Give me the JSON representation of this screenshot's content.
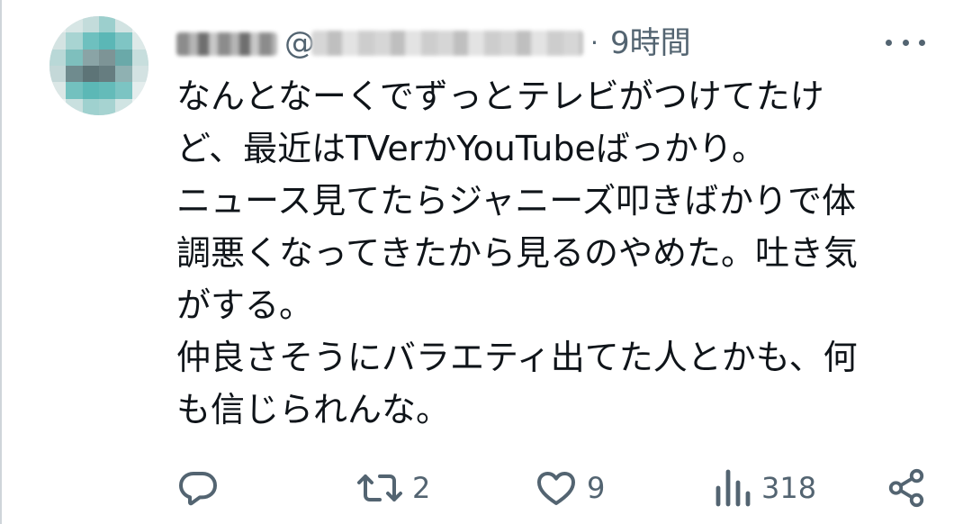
{
  "tweet": {
    "author_name_blurred": "",
    "handle_prefix": "@",
    "separator": "·",
    "timestamp": "9時間",
    "text_lines": [
      "なんとなーくでずっとテレビがつけてたけ",
      "ど、最近はTVerかYouTubeばっかり。",
      "ニュース見てたらジャニーズ叩きばかりで体",
      "調悪くなってきたから見るのやめた。吐き気",
      "がする。",
      "仲良さそうにバラエティ出てた人とかも、何",
      "も信じられんな。"
    ]
  },
  "actions": {
    "reply_icon": "reply-icon",
    "retweet_icon": "retweet-icon",
    "retweet_count": "2",
    "like_icon": "heart-icon",
    "like_count": "9",
    "views_icon": "views-icon",
    "views_count": "318",
    "share_icon": "share-icon"
  },
  "colors": {
    "text": "#0f1419",
    "secondary": "#536471",
    "avatar_main": "#5fb6b5"
  }
}
